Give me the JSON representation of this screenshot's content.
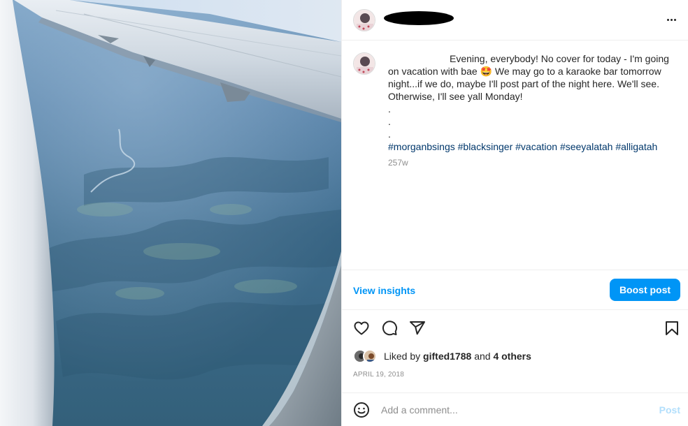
{
  "post": {
    "author": {
      "avatar": "avatar-icon",
      "username_redacted": true
    },
    "menu": {
      "icon": "more-options-icon"
    },
    "caption": {
      "text": "Evening, everybody! No cover for today - I'm going on vacation with bae 🤩 We may go to a karaoke bar tomorrow night...if we do, maybe I'll post part of the night here. We'll see. Otherwise, I'll see yall Monday!",
      "dots": [
        ".",
        ".",
        "."
      ],
      "hashtags": [
        "#morganbsings",
        "#blacksinger",
        "#vacation",
        "#seeyalatah",
        "#alligatah"
      ],
      "age": "257w"
    },
    "insights": {
      "label": "View insights"
    },
    "boost": {
      "label": "Boost post"
    },
    "actions": {
      "like": "heart-icon",
      "comment": "comment-icon",
      "share": "share-icon",
      "save": "bookmark-icon"
    },
    "likes": {
      "prefix": "Liked by",
      "user": "gifted1788",
      "joiner": "and",
      "others": "4 others"
    },
    "date": "APRIL 19, 2018",
    "comment": {
      "placeholder": "Add a comment...",
      "post_label": "Post",
      "emoji_icon": "emoji-icon"
    },
    "colors": {
      "accent": "#0095f6",
      "link": "#00376b",
      "muted": "#8e8e8e",
      "post_disabled": "#b2dffc"
    }
  }
}
